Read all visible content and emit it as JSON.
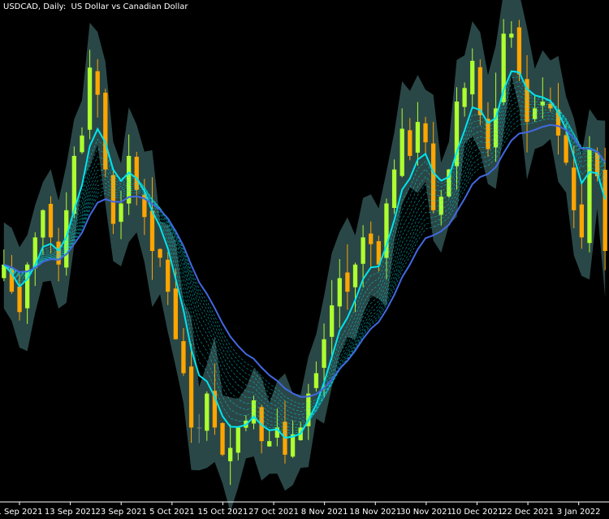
{
  "chart_data": {
    "type": "candlestick",
    "title": "USDCAD, Daily:  US Dollar vs Canadian Dollar",
    "symbol": "USDCAD",
    "timeframe": "Daily",
    "description": "US Dollar vs Canadian Dollar",
    "x_tick_labels": [
      "1 Sep 2021",
      "13 Sep 2021",
      "23 Sep 2021",
      "5 Oct 2021",
      "15 Oct 2021",
      "27 Oct 2021",
      "8 Nov 2021",
      "18 Nov 2021",
      "30 Nov 2021",
      "10 Dec 2021",
      "22 Dec 2021",
      "3 Jan 2022"
    ],
    "grid": false,
    "colors": {
      "background": "#000000",
      "bull_candle": "#adff2f",
      "bear_candle": "#ffa500",
      "doji_candle": "#7d8c7d",
      "envelope_band": "#2f4f4f",
      "fast_ma": "#00e5ee",
      "slow_ma": "#4169e1",
      "ribbon": "#1e90ff",
      "axis": "#ffffff"
    },
    "series_close": [
      1.262,
      1.258,
      1.255,
      1.262,
      1.266,
      1.27,
      1.266,
      1.262,
      1.27,
      1.278,
      1.281,
      1.291,
      1.287,
      1.276,
      1.268,
      1.271,
      1.278,
      1.273,
      1.269,
      1.264,
      1.263,
      1.258,
      1.251,
      1.246,
      1.238,
      1.238,
      1.243,
      1.238,
      1.234,
      1.235,
      1.238,
      1.239,
      1.242,
      1.236,
      1.236,
      1.238,
      1.234,
      1.237,
      1.238,
      1.243,
      1.246,
      1.251,
      1.256,
      1.26,
      1.258,
      1.262,
      1.266,
      1.265,
      1.262,
      1.271,
      1.276,
      1.282,
      1.278,
      1.283,
      1.28,
      1.27,
      1.272,
      1.276,
      1.286,
      1.288,
      1.292,
      1.284,
      1.279,
      1.285,
      1.296,
      1.296,
      1.29,
      1.283,
      1.285,
      1.286,
      1.285,
      1.281,
      1.277,
      1.27,
      1.266,
      1.279,
      1.275,
      1.264
    ]
  }
}
